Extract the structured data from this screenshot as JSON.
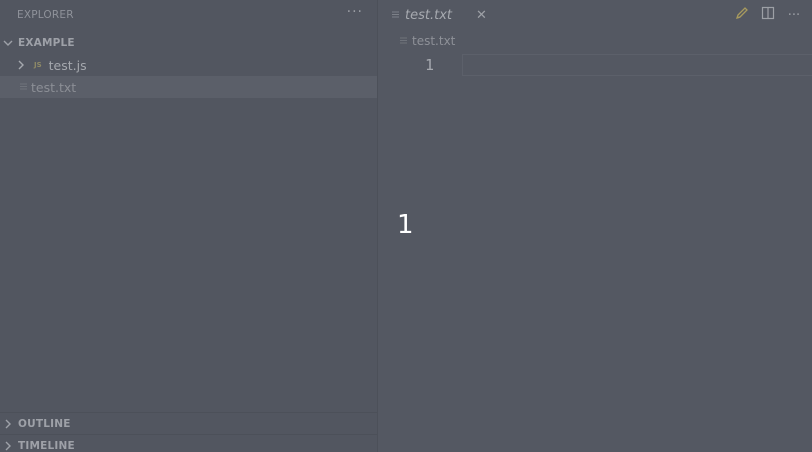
{
  "sidebar": {
    "title": "EXPLORER",
    "more_label": "···",
    "folder": {
      "name": "EXAMPLE",
      "items": [
        {
          "name": "test.js",
          "badge": "JS"
        },
        {
          "name": "test.txt"
        }
      ]
    },
    "panels": [
      {
        "label": "OUTLINE"
      },
      {
        "label": "TIMELINE"
      }
    ]
  },
  "editor": {
    "tab": {
      "label": "test.txt",
      "close": "✕"
    },
    "actions": {
      "more_label": "···"
    },
    "breadcrumb": {
      "file": "test.txt"
    },
    "gutter": {
      "line": "1"
    }
  },
  "overlay": {
    "number": "1"
  },
  "colors": {
    "background": "#545862",
    "sidebar": "#525660",
    "selected_row": "#5b5f69",
    "overlay_text": "#ffffff"
  }
}
